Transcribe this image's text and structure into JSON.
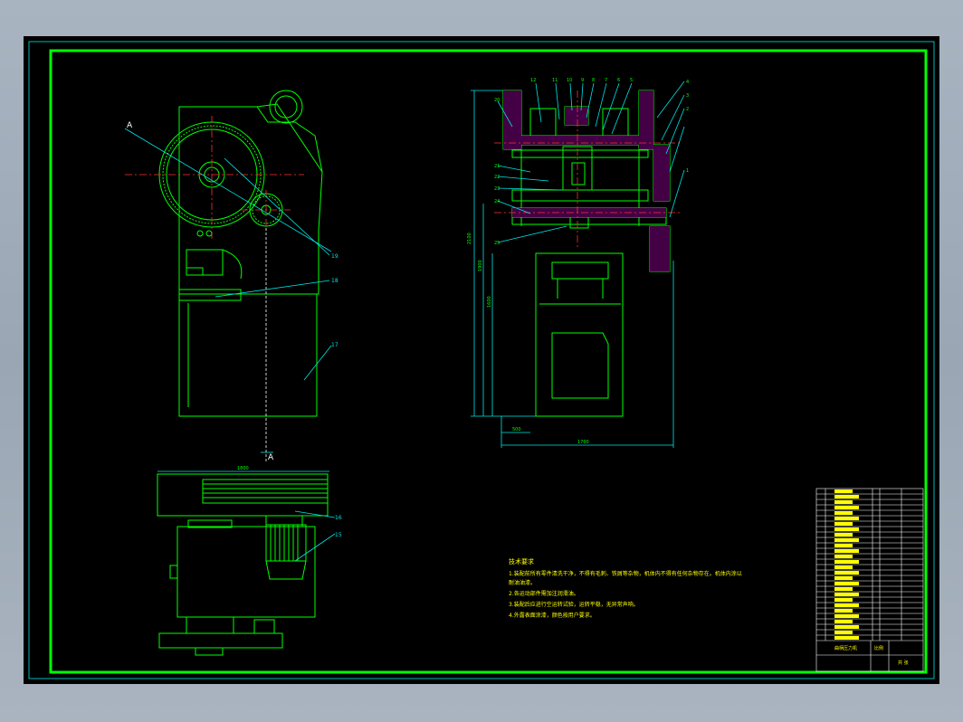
{
  "section_marker_top": "A",
  "section_marker_bottom": "A",
  "dim_labels": {
    "height_total": "2100",
    "height_mid": "1900",
    "height_low": "1600",
    "width_bottom": "1700",
    "width_small": "500",
    "plan_width": "1800"
  },
  "balloons": {
    "front_view": [
      "19",
      "18",
      "17"
    ],
    "plan_view": [
      "16",
      "15"
    ],
    "section_left": [
      "20",
      "21",
      "22",
      "23",
      "24",
      "25"
    ],
    "section_top": [
      "12",
      "11",
      "10",
      "9",
      "8",
      "7",
      "6",
      "5",
      "4",
      "3",
      "2",
      "1"
    ]
  },
  "tech_notes": {
    "title": "技术要求",
    "lines": [
      "1.装配前所有零件清洗干净，不得有毛刺、铁屑等杂物，机体内不得有任何杂物存在。机体内涂以",
      "  耐油油漆。",
      "2.各运动部件需加注润滑油。",
      "3.装配后应进行空运转试验，运转平稳，无异常声响。",
      "4.外露表面涂漆，颜色按用户要求。"
    ]
  },
  "title_block": {
    "rows": 28,
    "drawing_title": "曲柄压力机",
    "scale_label": "比例",
    "sheet_label": "共 张"
  },
  "colors": {
    "background": "#000000",
    "frame": "#00ff00",
    "centerline": "#ff3030",
    "annotation": "#00e5e5",
    "text": "#ffff00",
    "hatch": "#ff00ff"
  }
}
